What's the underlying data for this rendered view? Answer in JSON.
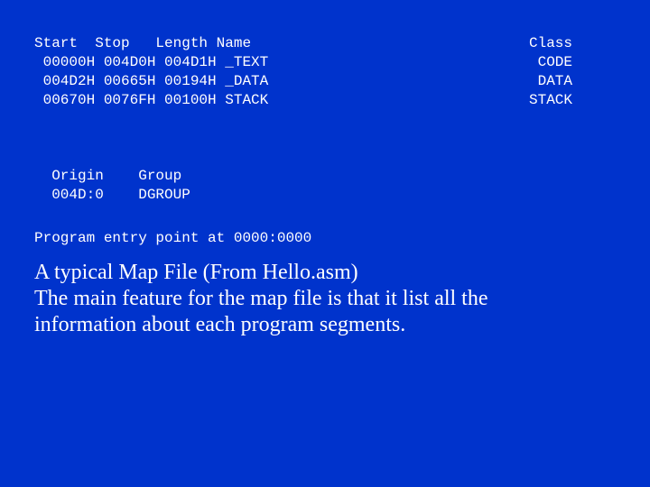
{
  "slide": {
    "background_color": "#0033cc",
    "text_color": "#ffffff"
  },
  "map_listing": {
    "header": {
      "left": "Start  Stop   Length Name",
      "class": "Class"
    },
    "segments": [
      {
        "left": " 00000H 004D0H 004D1H _TEXT",
        "class": "CODE"
      },
      {
        "left": " 004D2H 00665H 00194H _DATA",
        "class": "DATA"
      },
      {
        "left": " 00670H 0076FH 00100H STACK",
        "class": "STACK"
      }
    ],
    "origin_header": "  Origin    Group",
    "origin_values": "  004D:0    DGROUP",
    "entry_point": "Program entry point at 0000:0000"
  },
  "caption": {
    "lines": [
      "A typical Map File (From Hello.asm)",
      "The main feature for the map file is that it list all the",
      "information about each program segments."
    ]
  }
}
